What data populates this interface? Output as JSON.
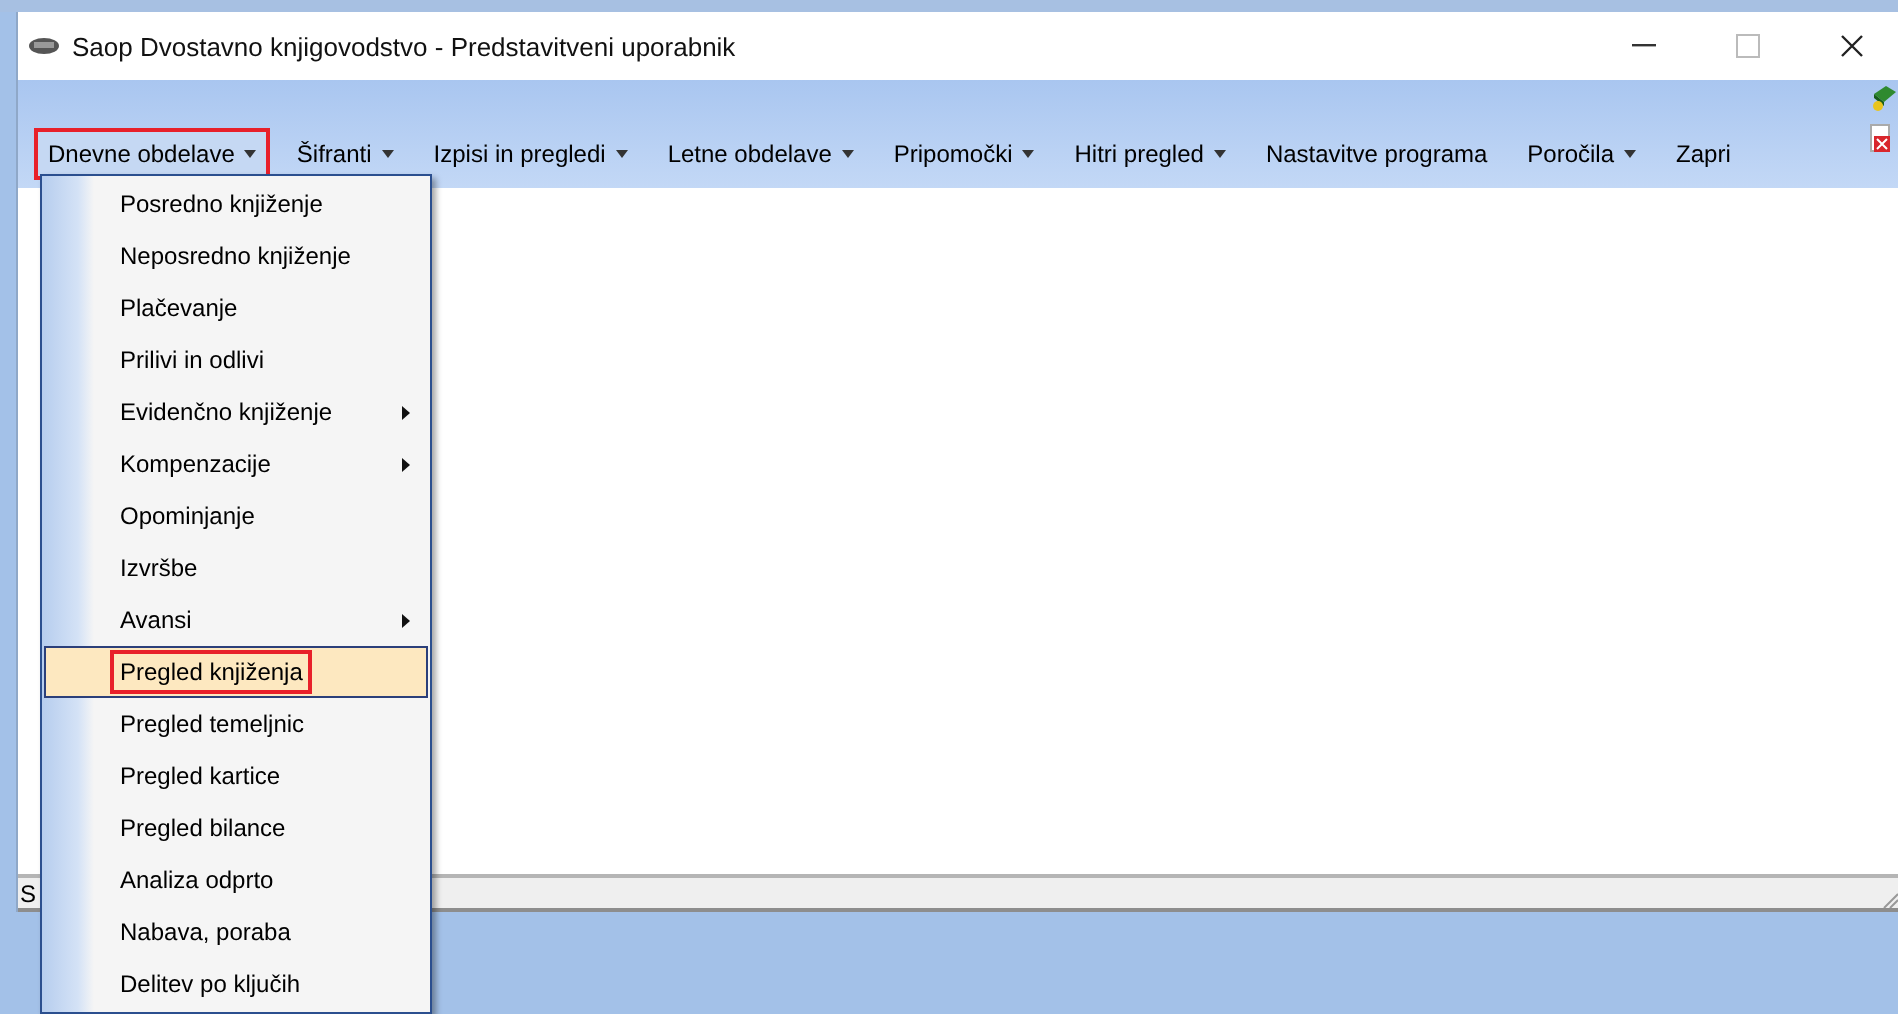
{
  "window": {
    "title": "Saop Dvostavno knjigovodstvo - Predstavitveni uporabnik"
  },
  "menu_bar": [
    {
      "label": "Dnevne obdelave",
      "dropdown": true,
      "open": true,
      "annotated": true
    },
    {
      "label": "Šifranti",
      "dropdown": true,
      "open": false,
      "annotated": false
    },
    {
      "label": "Izpisi in pregledi",
      "dropdown": true,
      "open": false,
      "annotated": false
    },
    {
      "label": "Letne obdelave",
      "dropdown": true,
      "open": false,
      "annotated": false
    },
    {
      "label": "Pripomočki",
      "dropdown": true,
      "open": false,
      "annotated": false
    },
    {
      "label": "Hitri pregled",
      "dropdown": true,
      "open": false,
      "annotated": false
    },
    {
      "label": "Nastavitve programa",
      "dropdown": false,
      "open": false,
      "annotated": false
    },
    {
      "label": "Poročila",
      "dropdown": true,
      "open": false,
      "annotated": false
    },
    {
      "label": "Zapri",
      "dropdown": false,
      "open": false,
      "annotated": false
    }
  ],
  "menu": [
    {
      "label": "Posredno knjiženje",
      "submenu": false,
      "selected": false,
      "annotated": false
    },
    {
      "label": "Neposredno knjiženje",
      "submenu": false,
      "selected": false,
      "annotated": false
    },
    {
      "label": "Plačevanje",
      "submenu": false,
      "selected": false,
      "annotated": false
    },
    {
      "label": "Prilivi in odlivi",
      "submenu": false,
      "selected": false,
      "annotated": false
    },
    {
      "label": "Evidenčno knjiženje",
      "submenu": true,
      "selected": false,
      "annotated": false
    },
    {
      "label": "Kompenzacije",
      "submenu": true,
      "selected": false,
      "annotated": false
    },
    {
      "label": "Opominjanje",
      "submenu": false,
      "selected": false,
      "annotated": false
    },
    {
      "label": "Izvršbe",
      "submenu": false,
      "selected": false,
      "annotated": false
    },
    {
      "label": "Avansi",
      "submenu": true,
      "selected": false,
      "annotated": false
    },
    {
      "label": "Pregled knjiženja",
      "submenu": false,
      "selected": true,
      "annotated": true
    },
    {
      "label": "Pregled temeljnic",
      "submenu": false,
      "selected": false,
      "annotated": false
    },
    {
      "label": "Pregled kartice",
      "submenu": false,
      "selected": false,
      "annotated": false
    },
    {
      "label": "Pregled bilance",
      "submenu": false,
      "selected": false,
      "annotated": false
    },
    {
      "label": "Analiza odprto",
      "submenu": false,
      "selected": false,
      "annotated": false
    },
    {
      "label": "Nabava, poraba",
      "submenu": false,
      "selected": false,
      "annotated": false
    },
    {
      "label": "Delitev po ključih",
      "submenu": false,
      "selected": false,
      "annotated": false
    }
  ],
  "status_bar": {
    "text": "S"
  }
}
